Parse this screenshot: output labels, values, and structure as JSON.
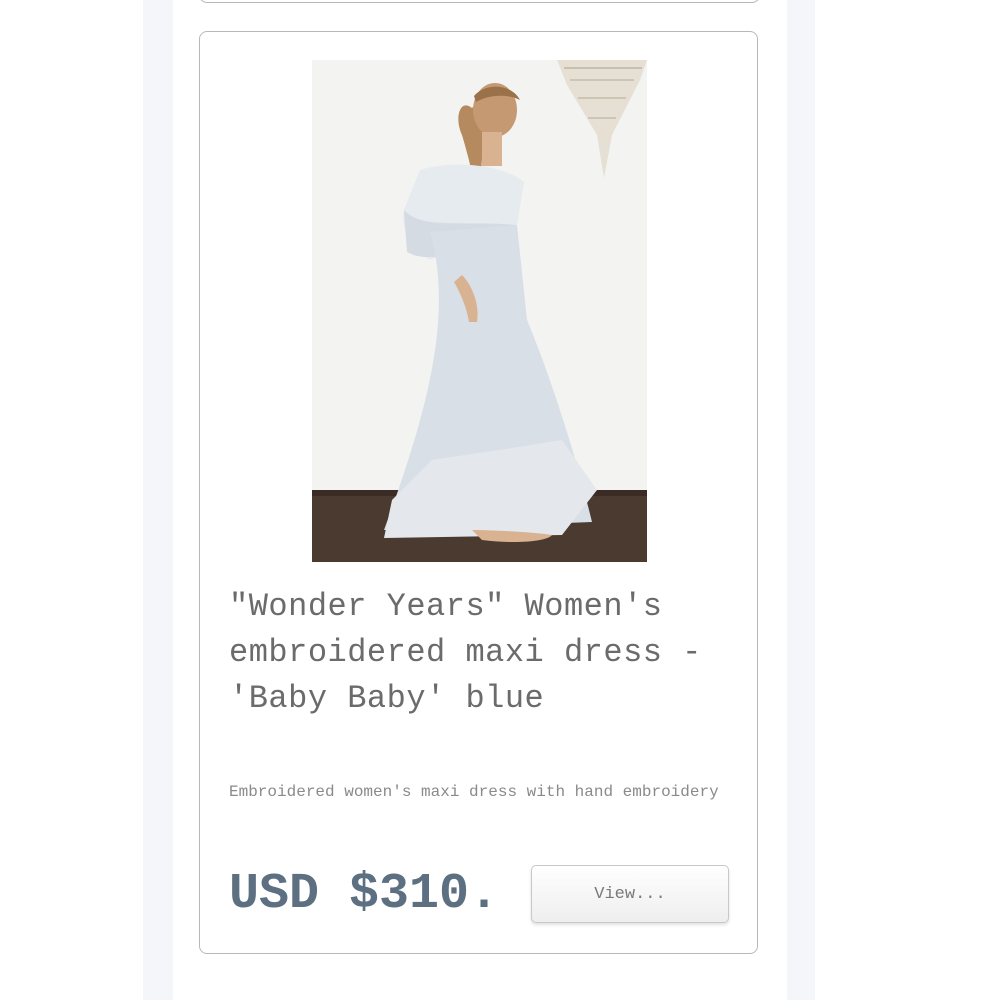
{
  "product": {
    "image_alt": "Woman in off-shoulder embroidered maxi dress",
    "title": "\"Wonder Years\" Women's embroidered maxi dress - 'Baby Baby' blue",
    "description": "Embroidered women's maxi dress with hand embroidery",
    "price": "USD $310.",
    "view_button_label": "View..."
  },
  "colors": {
    "page_background": "#ffffff",
    "side_band": "#f5f6fa",
    "card_border": "#b8b8b8",
    "title_text": "#6b6b6b",
    "description_text": "#8a8a8a",
    "price_text": "#5d7082"
  }
}
